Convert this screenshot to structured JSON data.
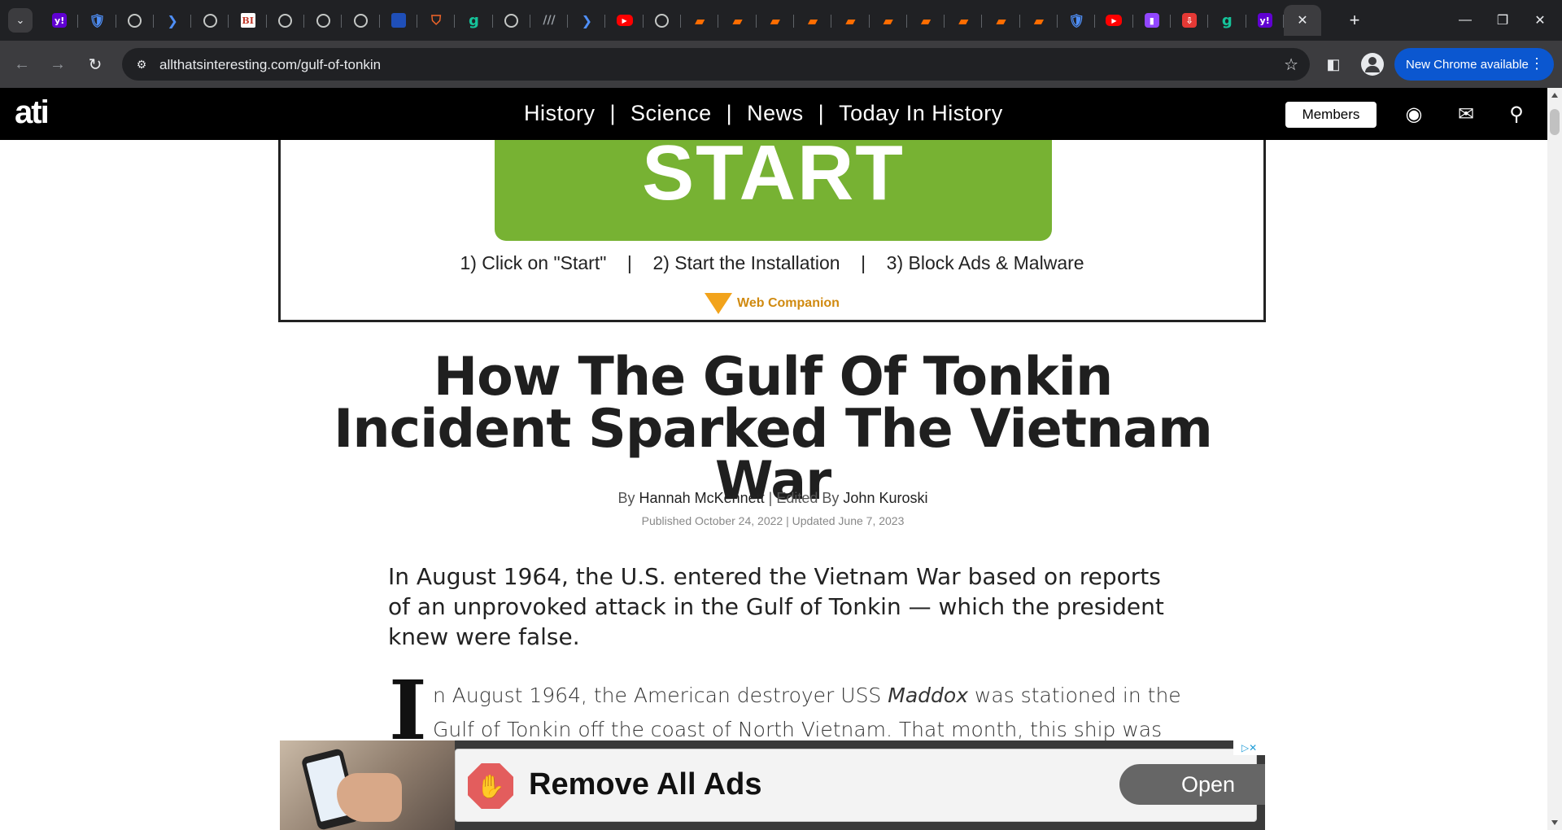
{
  "browser": {
    "tabs": [
      {
        "icon": "yahoo-icon",
        "glyph": "y!",
        "cls": "yahoo"
      },
      {
        "icon": "shield-outline-icon",
        "glyph": "🛡",
        "cls": "blue"
      },
      {
        "icon": "globe-icon",
        "glyph": "",
        "cls": "globe"
      },
      {
        "icon": "arrow-chevron-icon",
        "glyph": "❯",
        "cls": "blue"
      },
      {
        "icon": "globe-icon",
        "glyph": "",
        "cls": "globe"
      },
      {
        "icon": "business-insider-icon",
        "glyph": "BI",
        "cls": "bi"
      },
      {
        "icon": "globe-icon",
        "glyph": "",
        "cls": "globe"
      },
      {
        "icon": "globe-icon",
        "glyph": "",
        "cls": "globe"
      },
      {
        "icon": "globe-icon",
        "glyph": "",
        "cls": "globe"
      },
      {
        "icon": "cube-icon",
        "glyph": "",
        "cls": "cube"
      },
      {
        "icon": "shield-icon",
        "glyph": "⛉",
        "cls": "shield"
      },
      {
        "icon": "grammarly-g-icon",
        "glyph": "g",
        "cls": "g"
      },
      {
        "icon": "globe-icon",
        "glyph": "",
        "cls": "globe"
      },
      {
        "icon": "slashes-icon",
        "glyph": "///",
        "cls": "dark"
      },
      {
        "icon": "arrow-chevron-icon",
        "glyph": "❯",
        "cls": "blue"
      },
      {
        "icon": "youtube-icon",
        "glyph": "▶",
        "cls": "yt"
      },
      {
        "icon": "globe-icon",
        "glyph": "",
        "cls": "globe"
      },
      {
        "icon": "bookmark-icon",
        "glyph": "▰",
        "cls": "bm"
      },
      {
        "icon": "bookmark-icon",
        "glyph": "▰",
        "cls": "bm"
      },
      {
        "icon": "bookmark-icon",
        "glyph": "▰",
        "cls": "bm"
      },
      {
        "icon": "bookmark-icon",
        "glyph": "▰",
        "cls": "bm"
      },
      {
        "icon": "bookmark-icon",
        "glyph": "▰",
        "cls": "bm"
      },
      {
        "icon": "bookmark-icon",
        "glyph": "▰",
        "cls": "bm"
      },
      {
        "icon": "bookmark-icon",
        "glyph": "▰",
        "cls": "bm"
      },
      {
        "icon": "bookmark-icon",
        "glyph": "▰",
        "cls": "bm"
      },
      {
        "icon": "bookmark-icon",
        "glyph": "▰",
        "cls": "bm"
      },
      {
        "icon": "bookmark-icon",
        "glyph": "▰",
        "cls": "bm"
      },
      {
        "icon": "shield-outline-icon",
        "glyph": "🛡",
        "cls": "blue"
      },
      {
        "icon": "youtube-icon",
        "glyph": "▶",
        "cls": "yt"
      },
      {
        "icon": "twitch-icon",
        "glyph": "▮",
        "cls": "tw"
      },
      {
        "icon": "download-red-icon",
        "glyph": "⇩",
        "cls": "red2"
      },
      {
        "icon": "grammarly-g-icon",
        "glyph": "g",
        "cls": "g"
      },
      {
        "icon": "yahoo-icon",
        "glyph": "y!",
        "cls": "yahoo"
      }
    ],
    "active_tab_close": "✕",
    "new_tab": "+",
    "window": {
      "minimize": "—",
      "restore": "❐",
      "close": "✕"
    },
    "url": "allthatsinteresting.com/gulf-of-tonkin",
    "update_button": "New Chrome available",
    "update_menu": "⋮",
    "nav": {
      "back": "←",
      "forward": "→",
      "reload": "↻"
    },
    "site_info_icon": "⚙",
    "bookmark_star": "☆",
    "side_panel_icon": "◧"
  },
  "site": {
    "logo": "ati",
    "nav_items": [
      "History",
      "Science",
      "News",
      "Today In History"
    ],
    "nav_separator": "|",
    "members": "Members",
    "podcast_icon": "◉",
    "mail_icon": "✉",
    "search_icon": "⚲"
  },
  "ad_top": {
    "button_text": "START",
    "steps": "1) Click on \"Start\"    |    2) Start the Installation    |    3) Block Ads & Malware",
    "brand": "Web Companion"
  },
  "article": {
    "title": "How The Gulf Of Tonkin Incident Sparked The Vietnam War",
    "by_prefix": "By",
    "author": "Hannah McKennett",
    "edited_prefix": "| Edited By",
    "editor": "John Kuroski",
    "dates": "Published October 24, 2022  |  Updated June 7, 2023",
    "dek": "In August 1964, the U.S. entered the Vietnam War based on reports of an unprovoked attack in the Gulf of Tonkin — which the president knew were false.",
    "dropcap": "I",
    "body_part1": "n August 1964, the American destroyer USS ",
    "body_italic": "Maddox",
    "body_part2": " was stationed in the Gulf of Tonkin off the coast of North Vietnam. That month, this ship was"
  },
  "ad_bottom": {
    "headline": "Remove All Ads",
    "button": "Open",
    "adchoices": "▷✕",
    "stop_hand": "✋"
  }
}
